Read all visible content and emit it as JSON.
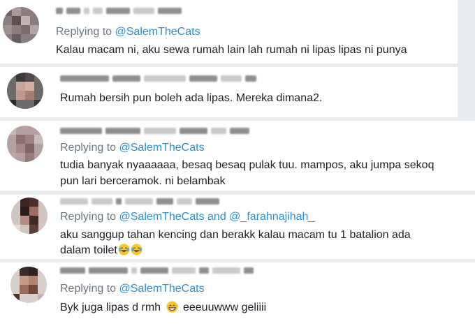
{
  "replies": [
    {
      "replying_prefix": "Replying to",
      "mention_1": "@SalemTheCats",
      "text": "Kalau macam ni, aku sewa rumah lain lah rumah ni lipas lipas ni punya"
    },
    {
      "text": "Rumah bersih pun boleh ada lipas. Mereka dimana2."
    },
    {
      "replying_prefix": "Replying to",
      "mention_1": "@SalemTheCats",
      "text_line_1": "tudia banyak nyaaaaaa, besaq besaq pulak tuu. mampos, aku jumpa sekoq",
      "text_line_2": "pun lari berceramok. ni belambak"
    },
    {
      "replying_prefix": "Replying to",
      "mention_1": "@SalemTheCats",
      "and_text": "and",
      "mention_2": "@_farahnajihah_",
      "text_line_1": "aku sanggup tahan kencing dan berakk kalau macam tu 1 batalion ada",
      "text_line_2": "dalam toilet",
      "emoji_1": "tears-of-joy-emoji",
      "emoji_2": "tears-of-joy-emoji"
    },
    {
      "replying_prefix": "Replying to",
      "mention_1": "@SalemTheCats",
      "text_before_emoji": "Byk juga lipas d rmh",
      "emoji": "grinning-emoji",
      "text_after_emoji": "eeeuuwww geliiii"
    }
  ],
  "colors": {
    "mention": "#2a8fd8",
    "secondary_text": "#6b7783",
    "body_text": "#1c2228",
    "background": "#e9ecef"
  }
}
